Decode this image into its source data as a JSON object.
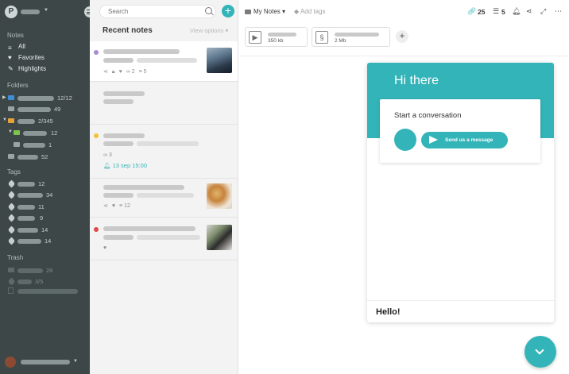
{
  "sidebar": {
    "account_initial": "P",
    "headings": {
      "notes": "Notes",
      "folders": "Folders",
      "tags": "Tags",
      "trash": "Trash"
    },
    "notes_items": [
      "All",
      "Favorites",
      "Highlights"
    ],
    "folder_counts": [
      "12/12",
      "49",
      "2/345",
      "12",
      "1",
      "52"
    ],
    "tag_counts": [
      "12",
      "34",
      "11",
      "9",
      "14",
      "14"
    ],
    "trash_counts": [
      "28",
      "3/5"
    ]
  },
  "notes_list": {
    "search_placeholder": "Search",
    "add_label": "+",
    "title": "Recent notes",
    "view_options": "View options",
    "notes": [
      {
        "dot_color": "#a98bd1",
        "link_count": "2",
        "list_count": "5"
      },
      {
        "dot_color": ""
      },
      {
        "dot_color": "#f2c230",
        "link_count": "3",
        "reminder": "13 sep 15:00"
      },
      {
        "dot_color": "",
        "list_count": "12"
      },
      {
        "dot_color": "#e04848"
      }
    ]
  },
  "main": {
    "breadcrumb": "My Notes",
    "add_tags": "Add tags",
    "attachment_count": "25",
    "checklist_count": "5",
    "attachments": [
      {
        "size": "350 kb",
        "icon": "video-file-icon"
      },
      {
        "size": "2 Mb",
        "icon": "archive-file-icon"
      }
    ],
    "add_attachment": "+"
  },
  "chat": {
    "title": "Hi there",
    "card_title": "Start a conversation",
    "send_label": "Send us a message",
    "footer": "Hello!"
  },
  "colors": {
    "accent": "#33b4b8",
    "sidebar": "#3e4748"
  }
}
